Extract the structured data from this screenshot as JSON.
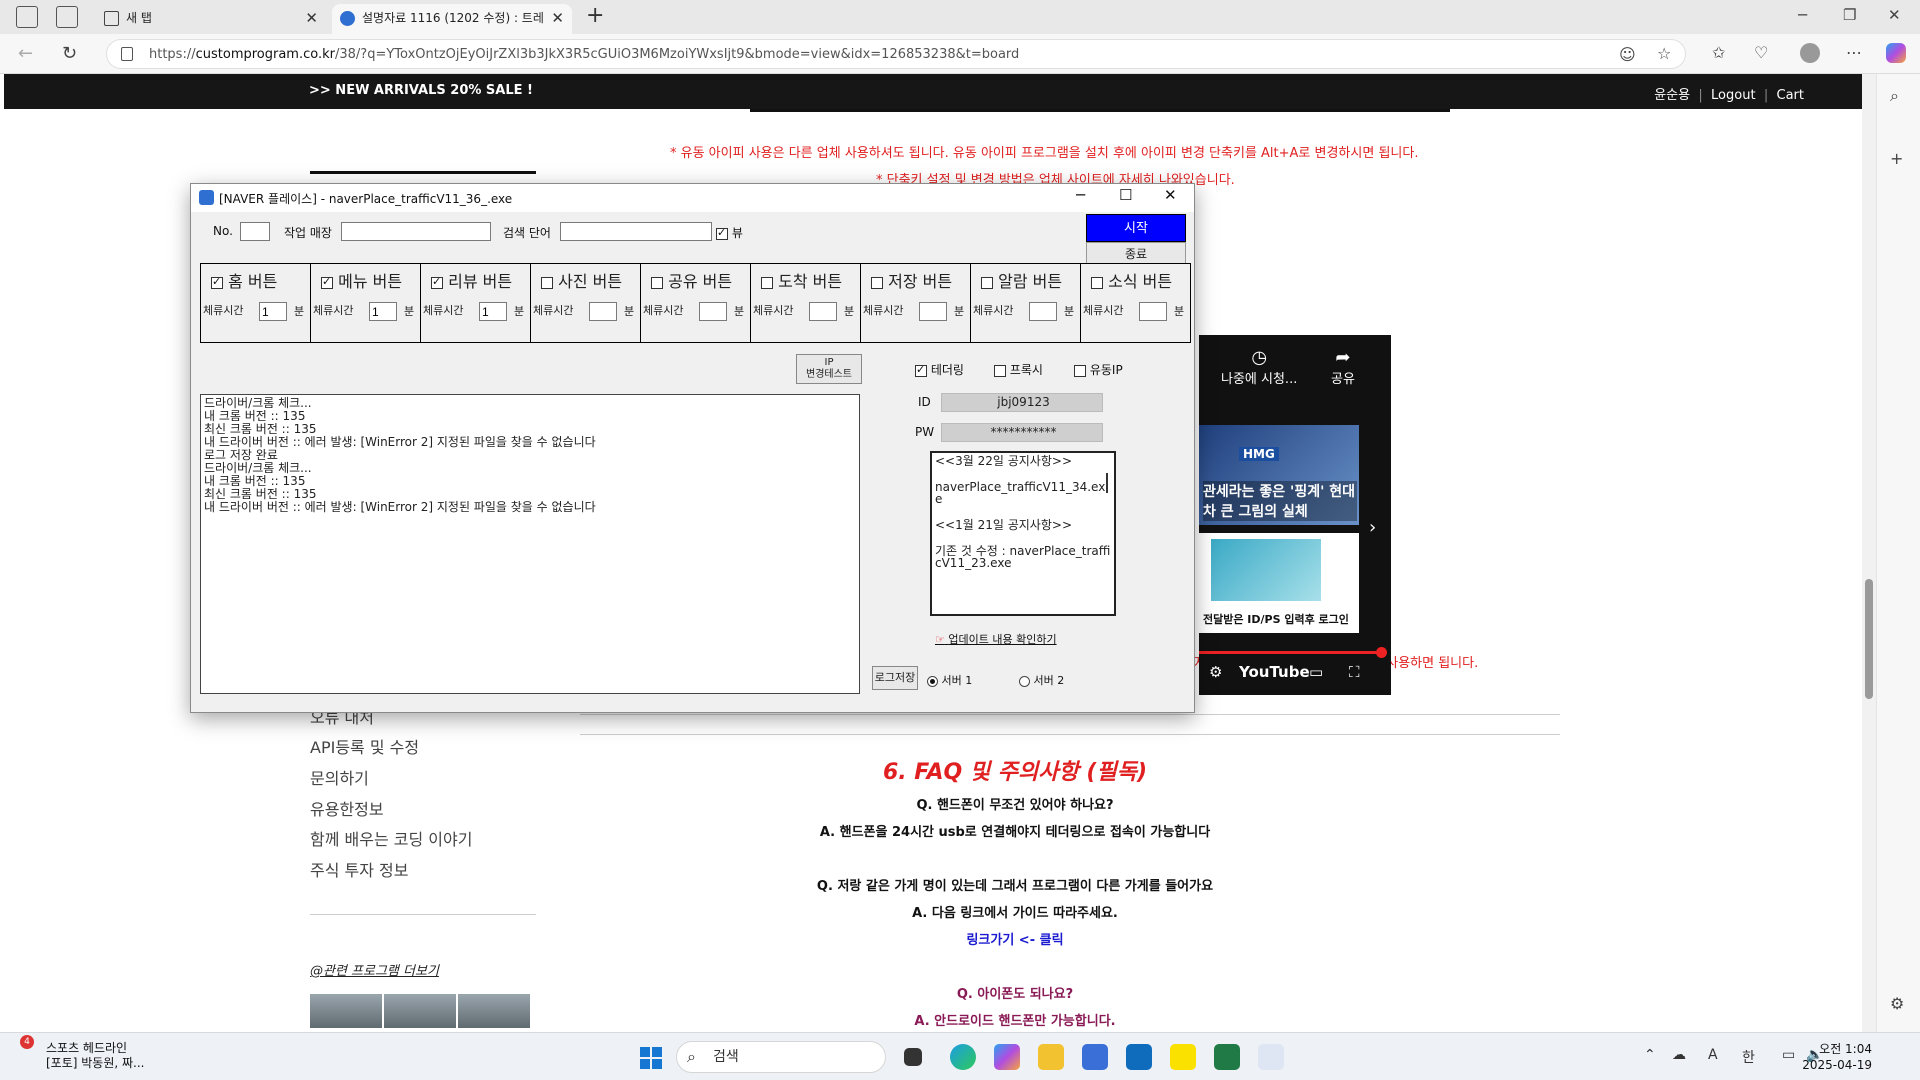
{
  "browser": {
    "tabs": [
      {
        "label": "새 탭"
      },
      {
        "label": "설명자료 1116 (1202 수정) : 트레"
      }
    ],
    "url_prefix": "https://",
    "url_host": "customprogram.co.kr",
    "url_rest": "/38/?q=YToxOntzOjEyOiJrZXl3b3JkX3R5cGUiO3M6MzoiYWxsIjt9&bmode=view&idx=126853238&t=board",
    "tab_close": "✕",
    "new_tab": "+"
  },
  "site": {
    "sale_text": ">> NEW ARRIVALS 20% SALE !",
    "user_name": "윤순용",
    "logout": "Logout",
    "cart": "Cart",
    "notice_line1": "* 유동 아이피 사용은 다른 업체 사용하셔도 됩니다. 유동 아이피 프로그램을 설치 후에 아이피 변경 단축키를 Alt+A로 변경하시면 됩니다.",
    "notice_line2": "* 단축키 설정 및 변경 방법은 업체 사이트에 자세히 나와있습니다.",
    "red_tail": "지를 메모장에 복사 붙여 넣기 해서 사용하면 됩니다.",
    "sidebar_items": [
      "오류 대처",
      "API등록 및 수정",
      "문의하기",
      "유용한정보",
      "함께 배우는 코딩 이야기",
      "주식 투자 정보"
    ],
    "related_label": "@관련 프로그램 더보기",
    "faq_title": "6. FAQ 및 주의사항 (필독)",
    "faq": [
      {
        "text": "Q. 핸드폰이 무조건 있어야 하나요?",
        "style": "q"
      },
      {
        "text": "A. 핸드폰을 24시간 usb로 연결해야지 테더링으로 접속이 가능합니다",
        "style": "a"
      },
      {
        "text": "Q. 저랑 같은 가게 명이 있는데 그래서 프로그램이 다른 가게를 들어가요",
        "style": "q"
      },
      {
        "text": "A. 다음 링크에서 가이드 따라주세요.",
        "style": "a"
      },
      {
        "text": "링크가기 <- 클릭",
        "style": "link"
      },
      {
        "text": "Q. 아이폰도 되나요?",
        "style": "q2"
      },
      {
        "text": "A. 안드로이드 핸드폰만 가능합니다.",
        "style": "a2"
      }
    ]
  },
  "video": {
    "watch_later": "나중에 시청...",
    "share": "공유",
    "thumb1_caption": "관세라는 좋은 '핑계' 현대차 큰 그림의 실체",
    "thumb1_badge": "HMG",
    "thumb2_caption": "전달받은 ID/PS 입력후 로그인",
    "brand": "YouTube"
  },
  "app": {
    "title": "[NAVER 플레이스] - naverPlace_trafficV11_36_.exe",
    "no_label": "No.",
    "store_label": "작업 매장",
    "keyword_label": "검색 단어",
    "view_label": "뷰",
    "view_checked": true,
    "start": "시작",
    "end": "종료",
    "stay_label": "체류시간",
    "unit": "분",
    "buttons": [
      {
        "label": "홈 버튼",
        "checked": true,
        "minutes": "1"
      },
      {
        "label": "메뉴 버튼",
        "checked": true,
        "minutes": "1"
      },
      {
        "label": "리뷰 버튼",
        "checked": true,
        "minutes": "1"
      },
      {
        "label": "사진 버튼",
        "checked": false,
        "minutes": ""
      },
      {
        "label": "공유 버튼",
        "checked": false,
        "minutes": ""
      },
      {
        "label": "도착 버튼",
        "checked": false,
        "minutes": ""
      },
      {
        "label": "저장 버튼",
        "checked": false,
        "minutes": ""
      },
      {
        "label": "알람 버튼",
        "checked": false,
        "minutes": ""
      },
      {
        "label": "소식 버튼",
        "checked": false,
        "minutes": ""
      }
    ],
    "ip_test_line1": "IP",
    "ip_test_line2": "변경테스트",
    "tethering": "테더링",
    "tethering_checked": true,
    "proxy": "프록시",
    "dynamic_ip": "유동IP",
    "id_label": "ID",
    "id_value": "jbj09123",
    "pw_label": "PW",
    "pw_value": "***********",
    "log_lines": [
      "드라이버/크롬 체크...",
      "내 크롬 버전 :: 135",
      "최신 크롬 버전 :: 135",
      "내 드라이버 버전 :: 에러 발생: [WinError 2] 지정된 파일을 찾을 수 없습니다",
      "로그 저장 완료",
      "드라이버/크롬 체크...",
      "내 크롬 버전 :: 135",
      "최신 크롬 버전 :: 135",
      "내 드라이버 버전 :: 에러 발생: [WinError 2] 지정된 파일을 찾을 수 없습니다"
    ],
    "notices": [
      "<<3월 22일 공지사항>>",
      "naverPlace_trafficV11_34.exe",
      "<<1월 21일 공지사항>>",
      "기존 것 수정 : naverPlace_trafficV11_23.exe"
    ],
    "update_link": "업데이트 내용 확인하기",
    "log_save": "로그저장",
    "server1": "서버 1",
    "server2": "서버 2",
    "server_selected": 1
  },
  "taskbar": {
    "news_badge": "4",
    "news_title": "스포츠 헤드라인",
    "news_sub": "[포토] 박동원, 짜...",
    "search_placeholder": "검색",
    "time": "오전 1:04",
    "date": "2025-04-19",
    "ime": "A",
    "lang": "한"
  }
}
